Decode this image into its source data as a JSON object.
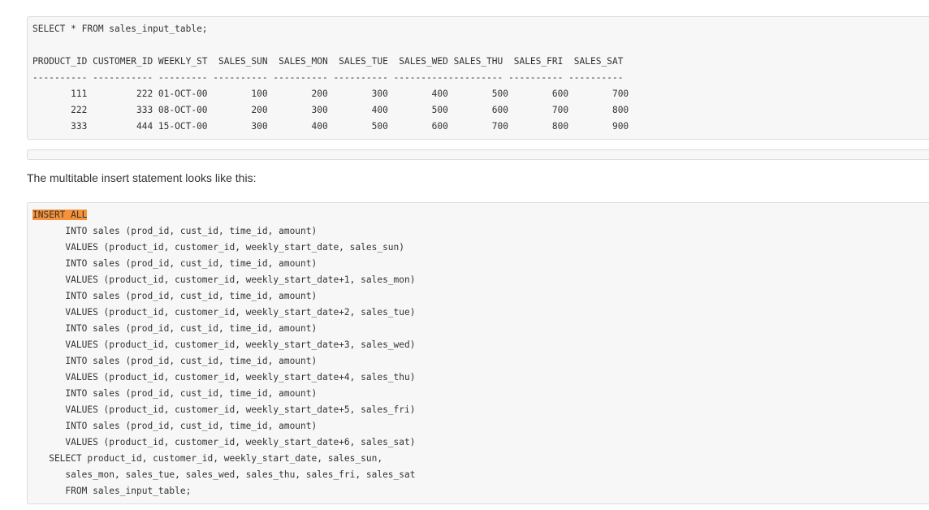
{
  "query_block": {
    "lines": [
      "SELECT * FROM sales_input_table;",
      "",
      "PRODUCT_ID CUSTOMER_ID WEEKLY_ST  SALES_SUN  SALES_MON  SALES_TUE  SALES_WED SALES_THU  SALES_FRI  SALES_SAT",
      "---------- ----------- --------- ---------- ---------- ---------- -------------------- ---------- ----------",
      "       111         222 01-OCT-00        100        200        300        400        500        600        700",
      "       222         333 08-OCT-00        200        300        400        500        600        700        800",
      "       333         444 15-OCT-00        300        400        500        600        700        800        900"
    ]
  },
  "description": "The multitable insert statement looks like this:",
  "insert_block": {
    "highlight": "INSERT ALL",
    "lines": [
      "      INTO sales (prod_id, cust_id, time_id, amount)",
      "      VALUES (product_id, customer_id, weekly_start_date, sales_sun)",
      "      INTO sales (prod_id, cust_id, time_id, amount)",
      "      VALUES (product_id, customer_id, weekly_start_date+1, sales_mon)",
      "      INTO sales (prod_id, cust_id, time_id, amount)",
      "      VALUES (product_id, customer_id, weekly_start_date+2, sales_tue)",
      "      INTO sales (prod_id, cust_id, time_id, amount)",
      "      VALUES (product_id, customer_id, weekly_start_date+3, sales_wed)",
      "      INTO sales (prod_id, cust_id, time_id, amount)",
      "      VALUES (product_id, customer_id, weekly_start_date+4, sales_thu)",
      "      INTO sales (prod_id, cust_id, time_id, amount)",
      "      VALUES (product_id, customer_id, weekly_start_date+5, sales_fri)",
      "      INTO sales (prod_id, cust_id, time_id, amount)",
      "      VALUES (product_id, customer_id, weekly_start_date+6, sales_sat)",
      "   SELECT product_id, customer_id, weekly_start_date, sales_sun,",
      "      sales_mon, sales_tue, sales_wed, sales_thu, sales_fri, sales_sat",
      "      FROM sales_input_table;"
    ]
  }
}
